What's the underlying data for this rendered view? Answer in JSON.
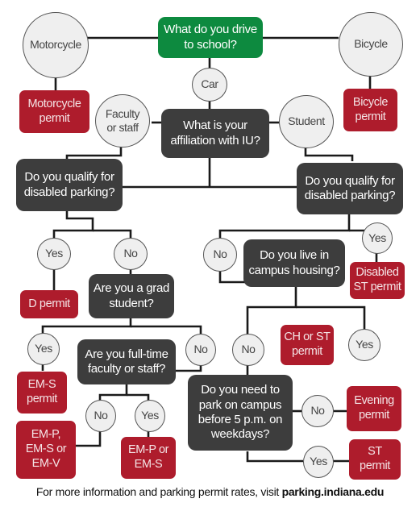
{
  "flowchart": {
    "start": {
      "label": "What do you drive\nto school?",
      "color": "#0d8a3f"
    },
    "answers": {
      "motorcycle": "Motorcycle",
      "bicycle": "Bicycle",
      "car": "Car",
      "faculty_staff": "Faculty\nor staff",
      "student": "Student",
      "fs_disabled_yes": "Yes",
      "fs_disabled_no": "No",
      "st_disabled_no": "No",
      "st_disabled_yes": "Yes",
      "grad_yes": "Yes",
      "grad_no": "No",
      "housing_no": "No",
      "housing_yes": "Yes",
      "fulltime_no": "No",
      "fulltime_yes": "Yes",
      "before5_no": "No",
      "before5_yes": "Yes"
    },
    "questions": {
      "affiliation": "What is your\naffiliation with IU?",
      "fs_disabled": "Do you qualify for\ndisabled parking?",
      "st_disabled": "Do you qualify for\ndisabled parking?",
      "grad_student": "Are you a grad\nstudent?",
      "campus_housing": "Do you live in\ncampus housing?",
      "fulltime": "Are you full-time\nfaculty or staff?",
      "before5": "Do you need to\npark on campus\nbefore 5 p.m. on\nweekdays?"
    },
    "permits": {
      "motorcycle": "Motorcycle\npermit",
      "bicycle": "Bicycle\npermit",
      "d": "D permit",
      "disabled_st": "Disabled\nST permit",
      "em_s": "EM-S\npermit",
      "ch_st": "CH or ST\npermit",
      "em_p_s_v": "EM-P,\nEM-S or\nEM-V",
      "em_p_s": "EM-P or\nEM-S",
      "evening": "Evening\npermit",
      "st": "ST\npermit"
    },
    "colors": {
      "question": "#3d3d3d",
      "permit": "#ae1c2c",
      "answer": "#efefef",
      "line": "#1a1a1a"
    }
  },
  "footer": {
    "text": "For more information and parking permit rates, visit ",
    "link": "parking.indiana.edu"
  }
}
